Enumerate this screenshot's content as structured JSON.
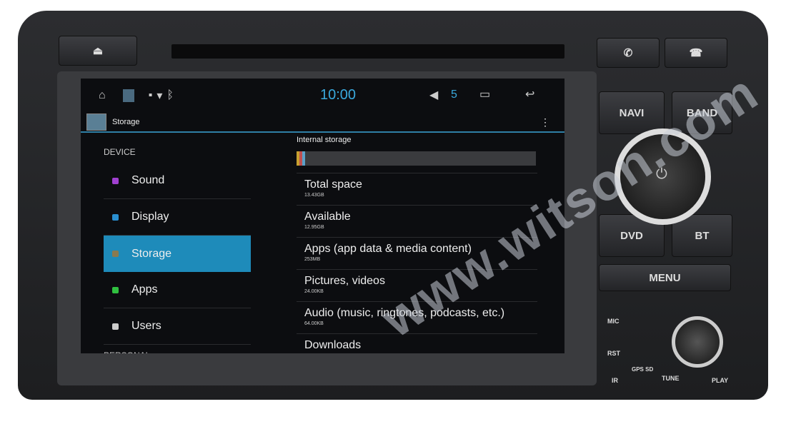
{
  "device": {
    "eject_icon": "eject-icon",
    "call_icon": "phone-call-icon",
    "hangup_icon": "phone-hangup-icon",
    "buttons": {
      "navi": "NAVI",
      "band": "BAND",
      "dvd": "DVD",
      "bt": "BT",
      "menu": "MENU",
      "mic": "MIC",
      "rst": "RST",
      "ir": "IR",
      "gps_sd": "GPS SD",
      "tune": "TUNE",
      "play": "PLAY"
    }
  },
  "status_bar": {
    "time": "10:00",
    "volume": "5",
    "icons": [
      "home-icon",
      "gallery-icon",
      "usb-icon",
      "wifi-icon",
      "bluetooth-icon",
      "volume-icon",
      "recent-apps-icon",
      "back-icon"
    ]
  },
  "action_bar": {
    "title": "Storage"
  },
  "sidebar": {
    "category": "DEVICE",
    "next_category": "PERSONAL",
    "items": [
      {
        "label": "Sound",
        "color": "#a040d0"
      },
      {
        "label": "Display",
        "color": "#2a8fd0"
      },
      {
        "label": "Storage",
        "color": "#8a7a50",
        "selected": true
      },
      {
        "label": "Apps",
        "color": "#30c040"
      },
      {
        "label": "Users",
        "color": "#cccccc"
      }
    ]
  },
  "storage": {
    "header": "Internal storage",
    "used_fraction": 0.035,
    "segment_colors": [
      "#c8a030",
      "#c05050",
      "#5aa0c8"
    ],
    "rows": [
      {
        "title": "Total space",
        "value": "13.43GB"
      },
      {
        "title": "Available",
        "value": "12.95GB"
      },
      {
        "title": "Apps (app data & media content)",
        "value": "253MB"
      },
      {
        "title": "Pictures, videos",
        "value": "24.00KB"
      },
      {
        "title": "Audio (music, ringtones, podcasts, etc.)",
        "value": "64.00KB"
      },
      {
        "title": "Downloads",
        "value": ""
      }
    ]
  },
  "watermark": "www.witson.com"
}
